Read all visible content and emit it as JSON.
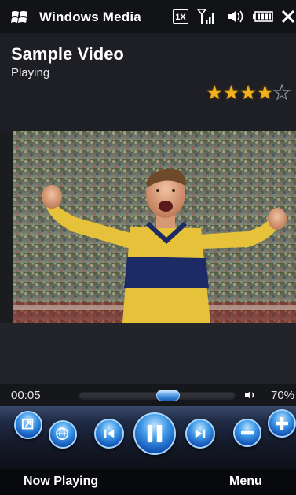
{
  "status_bar": {
    "app_title": "Windows Media",
    "network_label": "1X"
  },
  "header": {
    "title": "Sample Video",
    "state": "Playing",
    "rating_stars": 4,
    "rating_max": 5
  },
  "video": {
    "description_icon": "video-frame"
  },
  "seek": {
    "elapsed": "00:05",
    "position_fraction": 0.58
  },
  "volume": {
    "label": "70%"
  },
  "controls": {
    "icons": [
      "fullscreen-icon",
      "web-icon",
      "previous-icon",
      "pause-icon",
      "next-icon",
      "volume-down-icon",
      "volume-up-icon"
    ]
  },
  "softkeys": {
    "left": "Now Playing",
    "right": "Menu"
  },
  "colors": {
    "accent": "#2f7fd8",
    "star": "#f2b21c",
    "background": "#1b1c20"
  }
}
